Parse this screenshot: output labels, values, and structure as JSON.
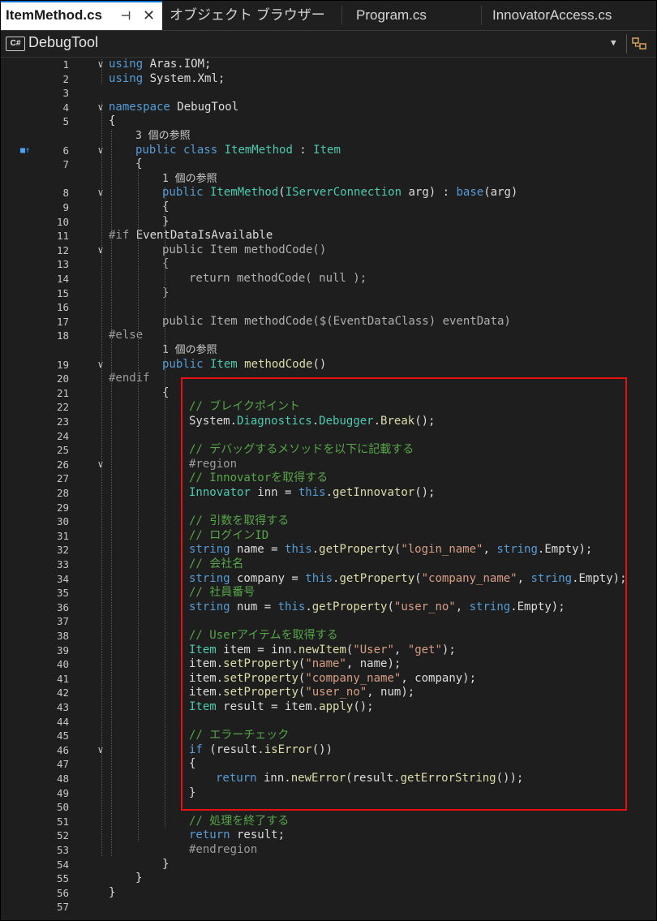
{
  "tabs": [
    {
      "label": "ItemMethod.cs",
      "active": true,
      "pin": "⊣",
      "close": "✕"
    },
    {
      "label": "オブジェクト ブラウザー",
      "active": false
    },
    {
      "label": "Program.cs",
      "active": false
    },
    {
      "label": "InnovatorAccess.cs",
      "active": false
    }
  ],
  "navbar": {
    "badge": "C#",
    "project": "DebugTool",
    "dropdown_icon": "chevron-down-icon",
    "right_icon": "class-member-icon"
  },
  "code_lines": [
    {
      "n": "1",
      "ind": 0,
      "fold": "v",
      "parts": [
        [
          "kw",
          "using"
        ],
        [
          "id",
          " Aras.IOM;"
        ]
      ]
    },
    {
      "n": "2",
      "ind": 0,
      "parts": [
        [
          "kw",
          "using"
        ],
        [
          "id",
          " System.Xml;"
        ]
      ]
    },
    {
      "n": "3",
      "ind": 0,
      "parts": []
    },
    {
      "n": "4",
      "ind": 0,
      "fold": "v",
      "parts": [
        [
          "kw",
          "namespace"
        ],
        [
          "id",
          " DebugTool"
        ]
      ]
    },
    {
      "n": "5",
      "ind": 0,
      "parts": [
        [
          "id",
          "{"
        ]
      ]
    },
    {
      "n": "",
      "ind": 1,
      "ref": true,
      "parts": [
        [
          "ref",
          "3 個の参照"
        ]
      ]
    },
    {
      "n": "6",
      "ind": 1,
      "fold": "v",
      "icon": "■↑",
      "parts": [
        [
          "kw",
          "public class"
        ],
        [
          "ty",
          " ItemMethod"
        ],
        [
          "id",
          " : "
        ],
        [
          "ty",
          "Item"
        ]
      ]
    },
    {
      "n": "7",
      "ind": 1,
      "parts": [
        [
          "id",
          "{"
        ]
      ]
    },
    {
      "n": "",
      "ind": 2,
      "ref": true,
      "parts": [
        [
          "ref",
          "1 個の参照"
        ]
      ]
    },
    {
      "n": "8",
      "ind": 2,
      "fold": "v",
      "parts": [
        [
          "kw",
          "public"
        ],
        [
          "ty",
          " ItemMethod"
        ],
        [
          "id",
          "("
        ],
        [
          "ty",
          "IServerConnection"
        ],
        [
          "id",
          " arg) : "
        ],
        [
          "kw",
          "base"
        ],
        [
          "id",
          "(arg)"
        ]
      ]
    },
    {
      "n": "9",
      "ind": 2,
      "parts": [
        [
          "id",
          "{"
        ]
      ]
    },
    {
      "n": "10",
      "ind": 2,
      "parts": [
        [
          "id",
          "}"
        ]
      ]
    },
    {
      "n": "11",
      "ind": 0,
      "parts": [
        [
          "pre",
          "#if "
        ],
        [
          "id",
          "EventDataIsAvailable"
        ]
      ]
    },
    {
      "n": "12",
      "ind": 2,
      "fold": "v",
      "parts": [
        [
          "inact",
          "public Item methodCode()"
        ]
      ]
    },
    {
      "n": "13",
      "ind": 2,
      "parts": [
        [
          "inact",
          "{"
        ]
      ]
    },
    {
      "n": "14",
      "ind": 3,
      "parts": [
        [
          "inact",
          "return methodCode( null );"
        ]
      ]
    },
    {
      "n": "15",
      "ind": 2,
      "parts": [
        [
          "inact",
          "}"
        ]
      ]
    },
    {
      "n": "16",
      "ind": 2,
      "parts": []
    },
    {
      "n": "17",
      "ind": 2,
      "parts": [
        [
          "inact",
          "public Item methodCode($(EventDataClass) eventData)"
        ]
      ]
    },
    {
      "n": "18",
      "ind": 0,
      "parts": [
        [
          "pre",
          "#else"
        ]
      ]
    },
    {
      "n": "",
      "ind": 2,
      "ref": true,
      "parts": [
        [
          "ref",
          "1 個の参照"
        ]
      ]
    },
    {
      "n": "19",
      "ind": 2,
      "fold": "v",
      "parts": [
        [
          "kw",
          "public"
        ],
        [
          "ty",
          " Item"
        ],
        [
          "fn",
          " methodCode"
        ],
        [
          "id",
          "()"
        ]
      ]
    },
    {
      "n": "20",
      "ind": 0,
      "parts": [
        [
          "pre",
          "#endif"
        ]
      ]
    },
    {
      "n": "21",
      "ind": 2,
      "parts": [
        [
          "id",
          "{"
        ]
      ]
    },
    {
      "n": "22",
      "ind": 3,
      "parts": [
        [
          "cm",
          "// ブレイクポイント"
        ]
      ]
    },
    {
      "n": "23",
      "ind": 3,
      "parts": [
        [
          "id",
          "System."
        ],
        [
          "ty",
          "Diagnostics"
        ],
        [
          "id",
          "."
        ],
        [
          "ty",
          "Debugger"
        ],
        [
          "id",
          "."
        ],
        [
          "fn",
          "Break"
        ],
        [
          "id",
          "();"
        ]
      ]
    },
    {
      "n": "24",
      "ind": 3,
      "parts": []
    },
    {
      "n": "25",
      "ind": 3,
      "parts": [
        [
          "cm",
          "// デバッグするメソッドを以下に記載する"
        ]
      ]
    },
    {
      "n": "26",
      "ind": 3,
      "fold": "v",
      "parts": [
        [
          "pre",
          "#region"
        ]
      ]
    },
    {
      "n": "27",
      "ind": 3,
      "parts": [
        [
          "cm",
          "// Innovatorを取得する"
        ]
      ]
    },
    {
      "n": "28",
      "ind": 3,
      "parts": [
        [
          "ty",
          "Innovator"
        ],
        [
          "id",
          " inn = "
        ],
        [
          "kw",
          "this"
        ],
        [
          "id",
          "."
        ],
        [
          "fn",
          "getInnovator"
        ],
        [
          "id",
          "();"
        ]
      ]
    },
    {
      "n": "29",
      "ind": 3,
      "parts": []
    },
    {
      "n": "30",
      "ind": 3,
      "parts": [
        [
          "cm",
          "// 引数を取得する"
        ]
      ]
    },
    {
      "n": "31",
      "ind": 3,
      "parts": [
        [
          "cm",
          "// ログインID"
        ]
      ]
    },
    {
      "n": "32",
      "ind": 3,
      "parts": [
        [
          "kw",
          "string"
        ],
        [
          "id",
          " name = "
        ],
        [
          "kw",
          "this"
        ],
        [
          "id",
          "."
        ],
        [
          "fn",
          "getProperty"
        ],
        [
          "id",
          "("
        ],
        [
          "str",
          "\"login_name\""
        ],
        [
          "id",
          ", "
        ],
        [
          "kw",
          "string"
        ],
        [
          "id",
          ".Empty);"
        ]
      ]
    },
    {
      "n": "33",
      "ind": 3,
      "parts": [
        [
          "cm",
          "// 会社名"
        ]
      ]
    },
    {
      "n": "34",
      "ind": 3,
      "parts": [
        [
          "kw",
          "string"
        ],
        [
          "id",
          " company = "
        ],
        [
          "kw",
          "this"
        ],
        [
          "id",
          "."
        ],
        [
          "fn",
          "getProperty"
        ],
        [
          "id",
          "("
        ],
        [
          "str",
          "\"company_name\""
        ],
        [
          "id",
          ", "
        ],
        [
          "kw",
          "string"
        ],
        [
          "id",
          ".Empty);"
        ]
      ]
    },
    {
      "n": "35",
      "ind": 3,
      "parts": [
        [
          "cm",
          "// 社員番号"
        ]
      ]
    },
    {
      "n": "36",
      "ind": 3,
      "parts": [
        [
          "kw",
          "string"
        ],
        [
          "id",
          " num = "
        ],
        [
          "kw",
          "this"
        ],
        [
          "id",
          "."
        ],
        [
          "fn",
          "getProperty"
        ],
        [
          "id",
          "("
        ],
        [
          "str",
          "\"user_no\""
        ],
        [
          "id",
          ", "
        ],
        [
          "kw",
          "string"
        ],
        [
          "id",
          ".Empty);"
        ]
      ]
    },
    {
      "n": "37",
      "ind": 3,
      "parts": []
    },
    {
      "n": "38",
      "ind": 3,
      "parts": [
        [
          "cm",
          "// Userアイテムを取得する"
        ]
      ]
    },
    {
      "n": "39",
      "ind": 3,
      "parts": [
        [
          "ty",
          "Item"
        ],
        [
          "id",
          " item = inn."
        ],
        [
          "fn",
          "newItem"
        ],
        [
          "id",
          "("
        ],
        [
          "str",
          "\"User\""
        ],
        [
          "id",
          ", "
        ],
        [
          "str",
          "\"get\""
        ],
        [
          "id",
          ");"
        ]
      ]
    },
    {
      "n": "40",
      "ind": 3,
      "parts": [
        [
          "id",
          "item."
        ],
        [
          "fn",
          "setProperty"
        ],
        [
          "id",
          "("
        ],
        [
          "str",
          "\"name\""
        ],
        [
          "id",
          ", name);"
        ]
      ]
    },
    {
      "n": "41",
      "ind": 3,
      "parts": [
        [
          "id",
          "item."
        ],
        [
          "fn",
          "setProperty"
        ],
        [
          "id",
          "("
        ],
        [
          "str",
          "\"company_name\""
        ],
        [
          "id",
          ", company);"
        ]
      ]
    },
    {
      "n": "42",
      "ind": 3,
      "parts": [
        [
          "id",
          "item."
        ],
        [
          "fn",
          "setProperty"
        ],
        [
          "id",
          "("
        ],
        [
          "str",
          "\"user_no\""
        ],
        [
          "id",
          ", num);"
        ]
      ]
    },
    {
      "n": "43",
      "ind": 3,
      "parts": [
        [
          "ty",
          "Item"
        ],
        [
          "id",
          " result = item."
        ],
        [
          "fn",
          "apply"
        ],
        [
          "id",
          "();"
        ]
      ]
    },
    {
      "n": "44",
      "ind": 3,
      "parts": []
    },
    {
      "n": "45",
      "ind": 3,
      "parts": [
        [
          "cm",
          "// エラーチェック"
        ]
      ]
    },
    {
      "n": "46",
      "ind": 3,
      "fold": "v",
      "parts": [
        [
          "kw",
          "if"
        ],
        [
          "id",
          " (result."
        ],
        [
          "fn",
          "isError"
        ],
        [
          "id",
          "())"
        ]
      ]
    },
    {
      "n": "47",
      "ind": 3,
      "parts": [
        [
          "id",
          "{"
        ]
      ]
    },
    {
      "n": "48",
      "ind": 4,
      "parts": [
        [
          "kw",
          "return"
        ],
        [
          "id",
          " inn."
        ],
        [
          "fn",
          "newError"
        ],
        [
          "id",
          "(result."
        ],
        [
          "fn",
          "getErrorString"
        ],
        [
          "id",
          "());"
        ]
      ]
    },
    {
      "n": "49",
      "ind": 3,
      "parts": [
        [
          "id",
          "}"
        ]
      ]
    },
    {
      "n": "50",
      "ind": 3,
      "parts": []
    },
    {
      "n": "51",
      "ind": 3,
      "parts": [
        [
          "cm",
          "// 処理を終了する"
        ]
      ]
    },
    {
      "n": "52",
      "ind": 3,
      "parts": [
        [
          "kw",
          "return"
        ],
        [
          "id",
          " result;"
        ]
      ]
    },
    {
      "n": "53",
      "ind": 3,
      "parts": [
        [
          "pre",
          "#endregion"
        ]
      ]
    },
    {
      "n": "54",
      "ind": 2,
      "parts": [
        [
          "id",
          "}"
        ]
      ]
    },
    {
      "n": "55",
      "ind": 1,
      "parts": [
        [
          "id",
          "}"
        ]
      ]
    },
    {
      "n": "56",
      "ind": 0,
      "parts": [
        [
          "id",
          "}"
        ]
      ]
    },
    {
      "n": "57",
      "ind": 0,
      "parts": []
    }
  ],
  "highlight_color": "#e81010",
  "colors": {
    "keyword": "#569cd6",
    "type": "#4ec9b0",
    "method": "#dcdcaa",
    "string": "#d69d85",
    "comment": "#57a64a",
    "background": "#1e1e1e"
  }
}
